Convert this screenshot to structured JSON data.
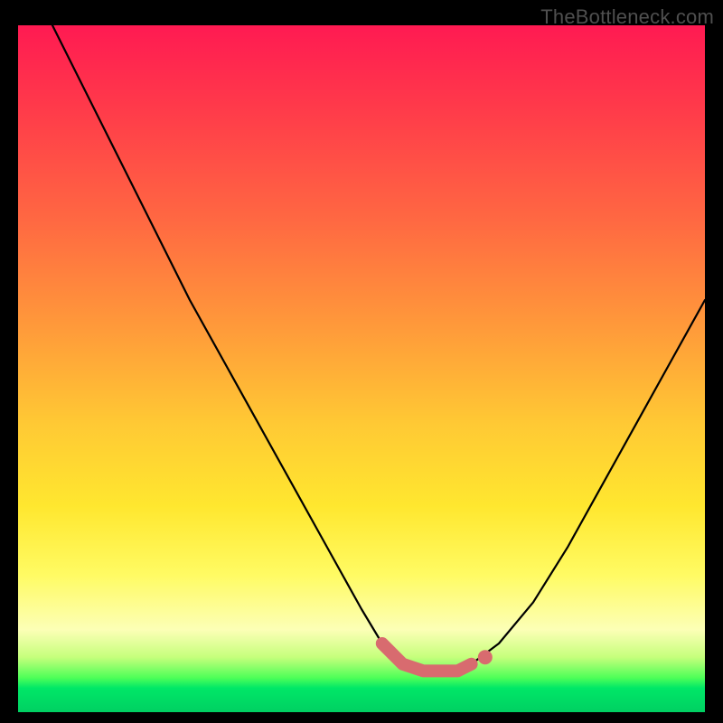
{
  "watermark": "TheBottleneck.com",
  "chart_data": {
    "type": "line",
    "title": "",
    "xlabel": "",
    "ylabel": "",
    "xlim": [
      0,
      100
    ],
    "ylim": [
      0,
      100
    ],
    "series": [
      {
        "name": "bottleneck-curve",
        "x": [
          5,
          10,
          15,
          20,
          25,
          30,
          35,
          40,
          45,
          50,
          53,
          56,
          59,
          62,
          64,
          66,
          70,
          75,
          80,
          85,
          90,
          95,
          100
        ],
        "values": [
          100,
          90,
          80,
          70,
          60,
          51,
          42,
          33,
          24,
          15,
          10,
          7,
          6,
          6,
          6,
          7,
          10,
          16,
          24,
          33,
          42,
          51,
          60
        ]
      }
    ],
    "highlight_segment": {
      "x": [
        53,
        56,
        59,
        62,
        64,
        66
      ],
      "values": [
        10,
        7,
        6,
        6,
        6,
        7
      ]
    },
    "marker_point": {
      "x": 68,
      "y": 8
    },
    "gradient_stops": [
      {
        "pos": 0,
        "color": "#ff1a52"
      },
      {
        "pos": 0.44,
        "color": "#ff9a3a"
      },
      {
        "pos": 0.7,
        "color": "#ffe72f"
      },
      {
        "pos": 0.88,
        "color": "#fcffb6"
      },
      {
        "pos": 0.96,
        "color": "#00e767"
      },
      {
        "pos": 1.0,
        "color": "#00d062"
      }
    ]
  }
}
